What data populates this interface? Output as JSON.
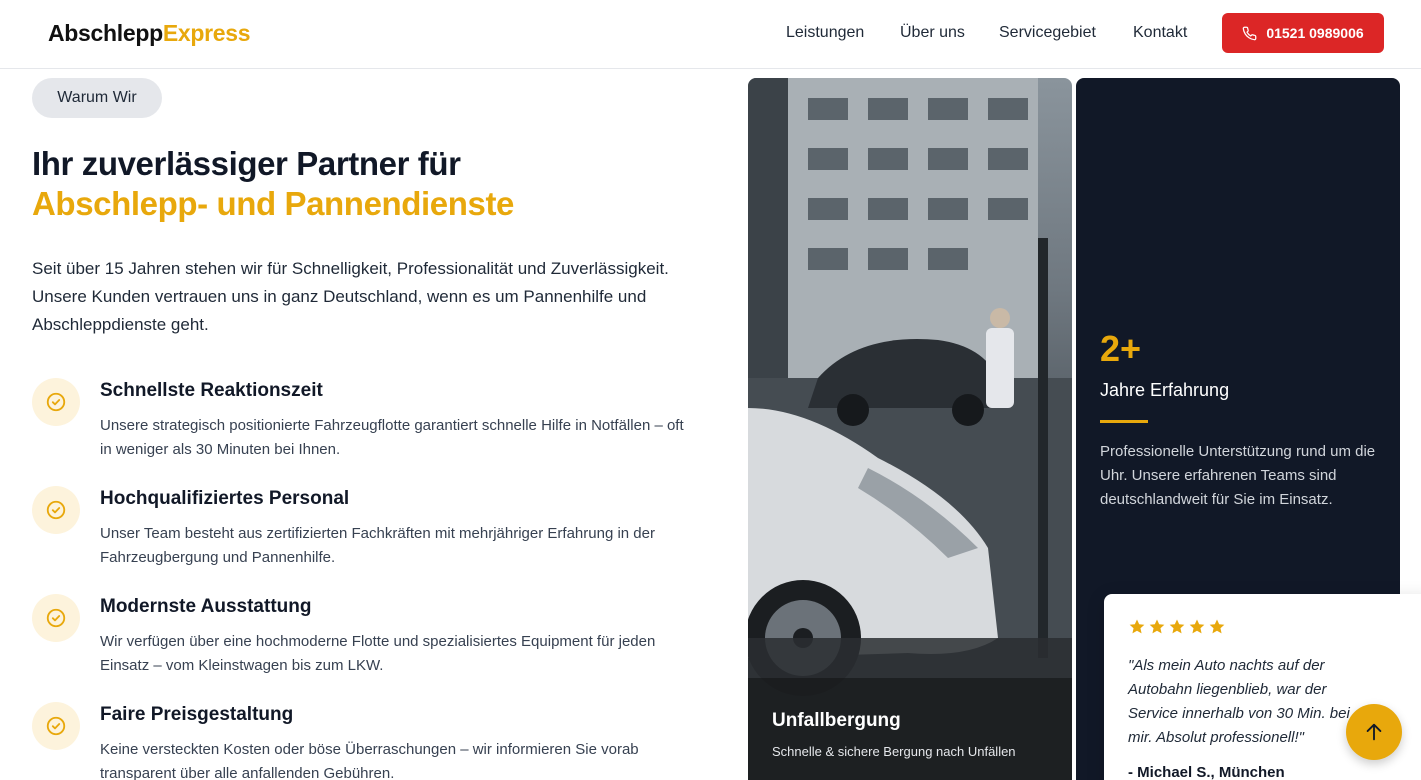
{
  "colors": {
    "accent": "#e8a80c",
    "cta": "#dc2626",
    "dark": "#111827"
  },
  "header": {
    "logo_part1": "Abschlepp",
    "logo_part2": "Express",
    "nav": [
      "Leistungen",
      "Über uns",
      "Servicegebiet",
      "Kontakt"
    ],
    "phone": "01521 0989006",
    "phone_icon": "phone-icon"
  },
  "section": {
    "badge": "Warum Wir",
    "title_line1": "Ihr zuverlässiger Partner für",
    "title_line2": "Abschlepp- und Pannendienste",
    "lead": "Seit über 15 Jahren stehen wir für Schnelligkeit, Professionalität und Zuverlässigkeit. Unsere Kunden vertrauen uns in ganz Deutschland, wenn es um Pannenhilfe und Abschleppdienste geht.",
    "features": [
      {
        "icon": "check-circle-icon",
        "title": "Schnellste Reaktionszeit",
        "text": "Unsere strategisch positionierte Fahrzeugflotte garantiert schnelle Hilfe in Notfällen – oft in weniger als 30 Minuten bei Ihnen."
      },
      {
        "icon": "check-circle-icon",
        "title": "Hochqualifiziertes Personal",
        "text": "Unser Team besteht aus zertifizierten Fachkräften mit mehrjähriger Erfahrung in der Fahrzeugbergung und Pannenhilfe."
      },
      {
        "icon": "check-circle-icon",
        "title": "Modernste Ausstattung",
        "text": "Wir verfügen über eine hochmoderne Flotte und spezialisiertes Equipment für jeden Einsatz – vom Kleinstwagen bis zum LKW."
      },
      {
        "icon": "check-circle-icon",
        "title": "Faire Preisgestaltung",
        "text": "Keine versteckten Kosten oder böse Überraschungen – wir informieren Sie vorab transparent über alle anfallenden Gebühren."
      }
    ]
  },
  "photo_card": {
    "title": "Unfallbergung",
    "subtitle": "Schnelle & sichere Bergung nach Unfällen"
  },
  "stat_card": {
    "value": "2+",
    "label": "Jahre Erfahrung",
    "text": "Professionelle Unterstützung rund um die Uhr. Unsere erfahrenen Teams sind deutschlandweit für Sie im Einsatz."
  },
  "review": {
    "rating": 5,
    "quote": "\"Als mein Auto nachts auf der Autobahn liegenblieb, war der Service innerhalb von 30 Min. bei mir. Absolut professionell!\"",
    "author": "- Michael S., München"
  },
  "scroll_top_icon": "arrow-up-icon"
}
